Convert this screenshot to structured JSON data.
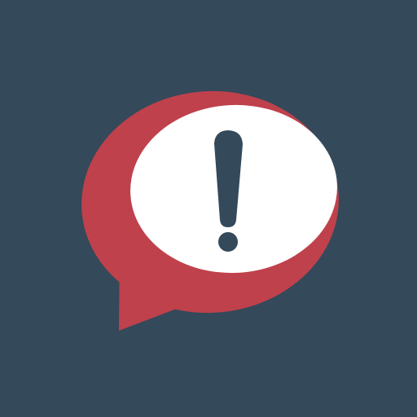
{
  "icon": {
    "name": "alert-speech-bubble-icon",
    "colors": {
      "background": "#34495A",
      "bubble": "#BF414C",
      "inner": "#FFFFFF",
      "mark": "#34495A"
    }
  }
}
